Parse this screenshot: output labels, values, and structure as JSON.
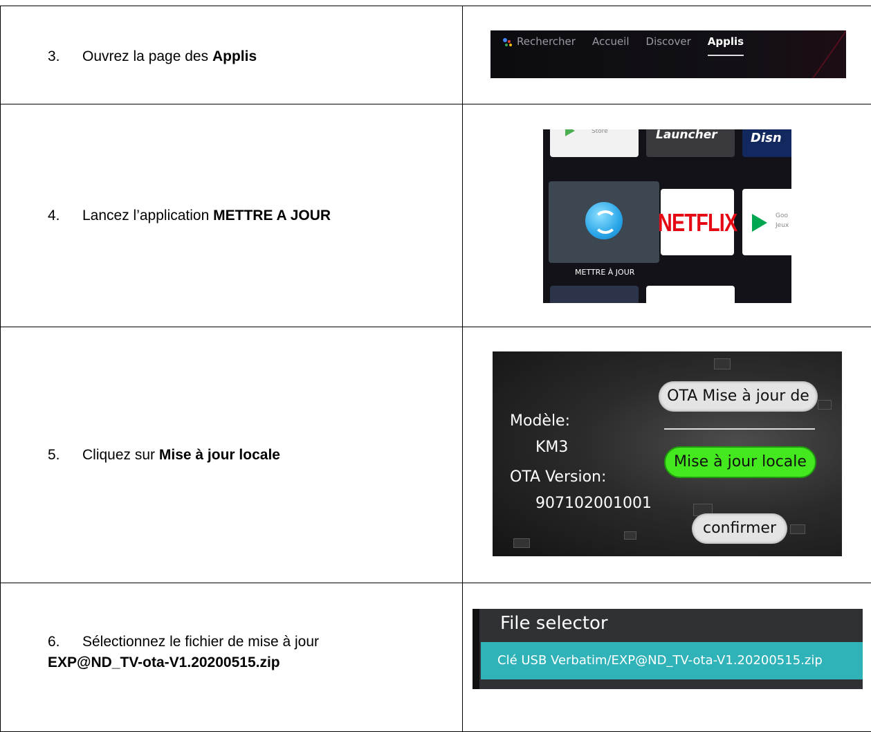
{
  "steps": [
    {
      "num": "3.",
      "text": "Ouvrez la page des ",
      "bold": "Applis"
    },
    {
      "num": "4.",
      "text": "Lancez l’application ",
      "bold": "METTRE A JOUR"
    },
    {
      "num": "5.",
      "text": "Cliquez sur ",
      "bold": "Mise à jour locale"
    },
    {
      "num": "6.",
      "text": "Sélectionnez le fichier de mise à jour",
      "bold": "EXP@ND_TV-ota-V1.20200515.zip"
    }
  ],
  "nav": {
    "items": [
      "Rechercher",
      "Accueil",
      "Discover",
      "Applis"
    ],
    "active": "Applis"
  },
  "apps": {
    "store_label": "Store",
    "launcher_label": "Launcher",
    "disney_label": "Disn",
    "netflix_label": "NETFLIX",
    "update_label": "METTRE À JOUR",
    "google_games_label_1": "Goo",
    "google_games_label_2": "Jeux"
  },
  "ota": {
    "model_label": "Modèle:",
    "model_value": "KM3",
    "version_label": "OTA Version:",
    "version_value": "907102001001",
    "ota_button": "OTA Mise à jour de",
    "local_button": "Mise à jour locale",
    "confirm_button": "confirmer"
  },
  "file_selector": {
    "title": "File selector",
    "path": "Clé USB Verbatim/EXP@ND_TV-ota-V1.20200515.zip"
  },
  "colors": {
    "green": "#44e81f",
    "teal": "#2fb3b8"
  }
}
